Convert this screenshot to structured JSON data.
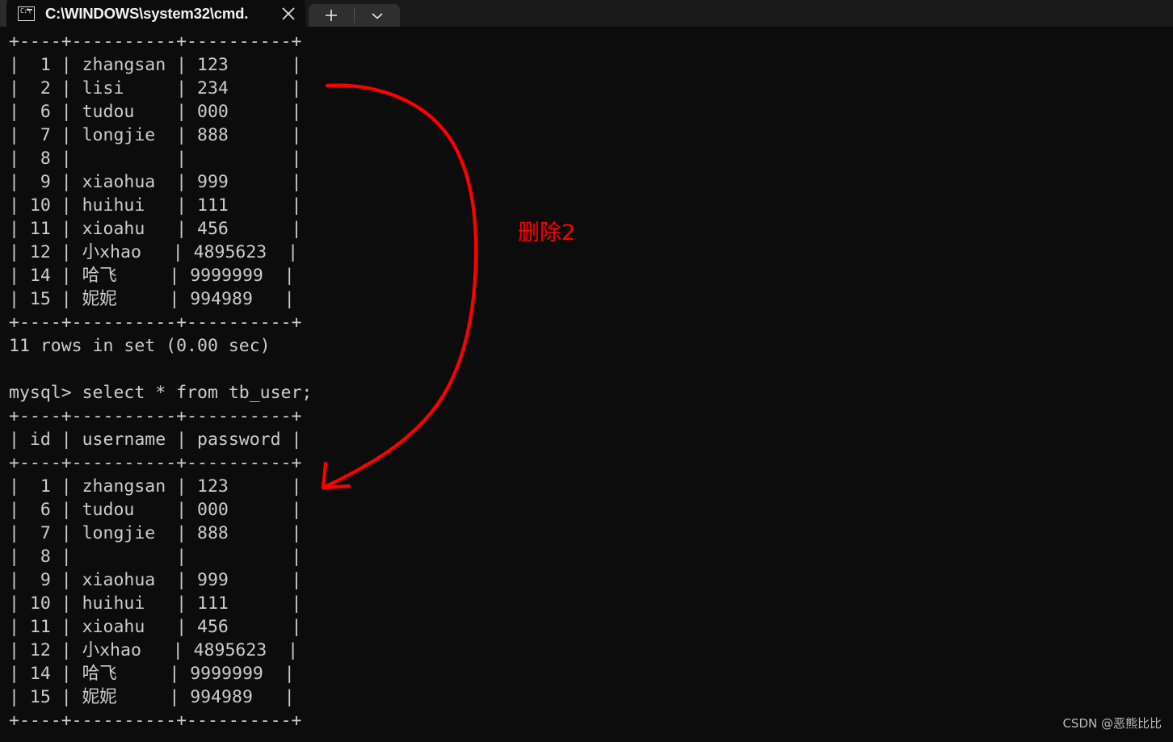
{
  "window": {
    "tab": {
      "title": "C:\\WINDOWS\\system32\\cmd.",
      "icon_name": "cmd-icon",
      "icon_glyph": "C:\\",
      "close_label": "✕"
    },
    "new_tab_label": "+",
    "dropdown_label": "⌄",
    "tabstrip_bg": "#191919",
    "tab_active_bg": "#0c0c0c"
  },
  "terminal": {
    "bg": "#0c0c0c",
    "fg": "#cccccc",
    "lines": [
      "+----+----------+----------+",
      "|  1 | zhangsan | 123      |",
      "|  2 | lisi     | 234      |",
      "|  6 | tudou    | 000      |",
      "|  7 | longjie  | 888      |",
      "|  8 |          |          |",
      "|  9 | xiaohua  | 999      |",
      "| 10 | huihui   | 111      |",
      "| 11 | xioahu   | 456      |",
      "| 12 | 小xhao   | 4895623  |",
      "| 14 | 哈飞     | 9999999  |",
      "| 15 | 妮妮     | 994989   |",
      "+----+----------+----------+",
      "11 rows in set (0.00 sec)",
      "",
      "mysql> select * from tb_user;",
      "+----+----------+----------+",
      "| id | username | password |",
      "+----+----------+----------+",
      "|  1 | zhangsan | 123      |",
      "|  6 | tudou    | 000      |",
      "|  7 | longjie  | 888      |",
      "|  8 |          |          |",
      "|  9 | xiaohua  | 999      |",
      "| 10 | huihui   | 111      |",
      "| 11 | xioahu   | 456      |",
      "| 12 | 小xhao   | 4895623  |",
      "| 14 | 哈飞     | 9999999  |",
      "| 15 | 妮妮     | 994989   |",
      "+----+----------+----------+"
    ],
    "result_status": "11 rows in set (0.00 sec)",
    "prompt_command": "mysql> select * from tb_user;",
    "table_headers": [
      "id",
      "username",
      "password"
    ],
    "first_result_rows": [
      [
        "1",
        "zhangsan",
        "123"
      ],
      [
        "2",
        "lisi",
        "234"
      ],
      [
        "6",
        "tudou",
        "000"
      ],
      [
        "7",
        "longjie",
        "888"
      ],
      [
        "8",
        "",
        ""
      ],
      [
        "9",
        "xiaohua",
        "999"
      ],
      [
        "10",
        "huihui",
        "111"
      ],
      [
        "11",
        "xioahu",
        "456"
      ],
      [
        "12",
        "小xhao",
        "4895623"
      ],
      [
        "14",
        "哈飞",
        "9999999"
      ],
      [
        "15",
        "妮妮",
        "994989"
      ]
    ],
    "second_result_rows": [
      [
        "1",
        "zhangsan",
        "123"
      ],
      [
        "6",
        "tudou",
        "000"
      ],
      [
        "7",
        "longjie",
        "888"
      ],
      [
        "8",
        "",
        ""
      ],
      [
        "9",
        "xiaohua",
        "999"
      ],
      [
        "10",
        "huihui",
        "111"
      ],
      [
        "11",
        "xioahu",
        "456"
      ],
      [
        "12",
        "小xhao",
        "4895623"
      ],
      [
        "14",
        "哈飞",
        "9999999"
      ],
      [
        "15",
        "妮妮",
        "994989"
      ]
    ]
  },
  "annotation": {
    "label": "删除2",
    "color": "#fe0000",
    "arrow_name": "curved-arrow"
  },
  "watermark": {
    "text": "CSDN @恶熊比比"
  }
}
